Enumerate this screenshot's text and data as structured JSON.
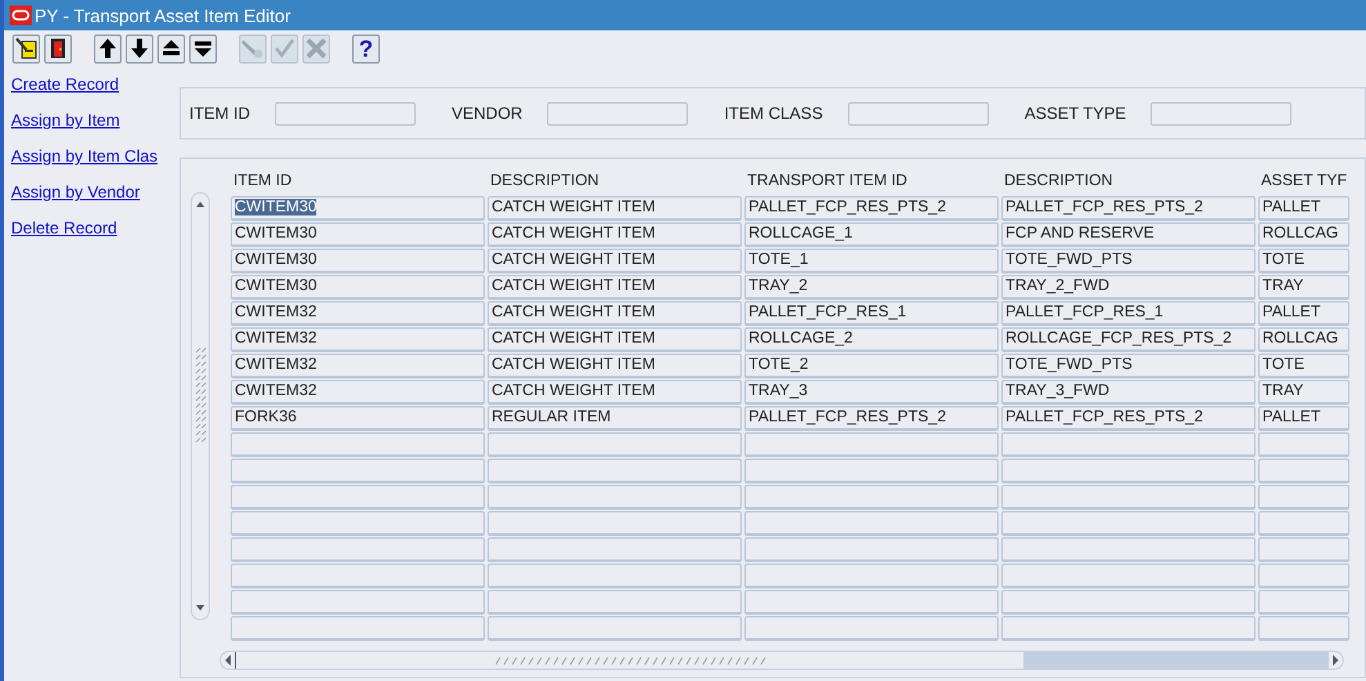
{
  "window": {
    "title": "PY - Transport Asset Item Editor"
  },
  "toolbar": [
    {
      "kind": "edit",
      "disabled": false
    },
    {
      "kind": "exit",
      "disabled": false
    },
    {
      "kind": "sep"
    },
    {
      "kind": "up",
      "disabled": false
    },
    {
      "kind": "down",
      "disabled": false
    },
    {
      "kind": "first",
      "disabled": false
    },
    {
      "kind": "last",
      "disabled": false
    },
    {
      "kind": "sep"
    },
    {
      "kind": "clear",
      "disabled": true
    },
    {
      "kind": "save",
      "disabled": true
    },
    {
      "kind": "cancel",
      "disabled": true
    },
    {
      "kind": "sep"
    },
    {
      "kind": "help",
      "disabled": false,
      "label": "?"
    }
  ],
  "sidebar": {
    "links": [
      "Create Record",
      "Assign by Item",
      "Assign by Item Clas",
      "Assign by Vendor",
      "Delete Record"
    ]
  },
  "filters": [
    {
      "label": "ITEM ID"
    },
    {
      "label": "VENDOR"
    },
    {
      "label": "ITEM CLASS"
    },
    {
      "label": "ASSET TYPE"
    }
  ],
  "table": {
    "columns": [
      "ITEM ID",
      "DESCRIPTION",
      "TRANSPORT ITEM ID",
      "DESCRIPTION",
      "ASSET TYF"
    ],
    "rows": [
      {
        "selected": true,
        "cells": [
          "CWITEM30",
          "CATCH WEIGHT ITEM",
          "PALLET_FCP_RES_PTS_2",
          "PALLET_FCP_RES_PTS_2",
          "PALLET"
        ]
      },
      {
        "selected": false,
        "cells": [
          "CWITEM30",
          "CATCH WEIGHT ITEM",
          "ROLLCAGE_1",
          "FCP AND RESERVE",
          "ROLLCAG"
        ]
      },
      {
        "selected": false,
        "cells": [
          "CWITEM30",
          "CATCH WEIGHT ITEM",
          "TOTE_1",
          "TOTE_FWD_PTS",
          "TOTE"
        ]
      },
      {
        "selected": false,
        "cells": [
          "CWITEM30",
          "CATCH WEIGHT ITEM",
          "TRAY_2",
          "TRAY_2_FWD",
          "TRAY"
        ]
      },
      {
        "selected": false,
        "cells": [
          "CWITEM32",
          "CATCH WEIGHT ITEM",
          "PALLET_FCP_RES_1",
          "PALLET_FCP_RES_1",
          "PALLET"
        ]
      },
      {
        "selected": false,
        "cells": [
          "CWITEM32",
          "CATCH WEIGHT ITEM",
          "ROLLCAGE_2",
          "ROLLCAGE_FCP_RES_PTS_2",
          "ROLLCAG"
        ]
      },
      {
        "selected": false,
        "cells": [
          "CWITEM32",
          "CATCH WEIGHT ITEM",
          "TOTE_2",
          "TOTE_FWD_PTS",
          "TOTE"
        ]
      },
      {
        "selected": false,
        "cells": [
          "CWITEM32",
          "CATCH WEIGHT ITEM",
          "TRAY_3",
          "TRAY_3_FWD",
          "TRAY"
        ]
      },
      {
        "selected": false,
        "cells": [
          "FORK36",
          "REGULAR ITEM",
          "PALLET_FCP_RES_PTS_2",
          "PALLET_FCP_RES_PTS_2",
          "PALLET"
        ]
      }
    ]
  }
}
